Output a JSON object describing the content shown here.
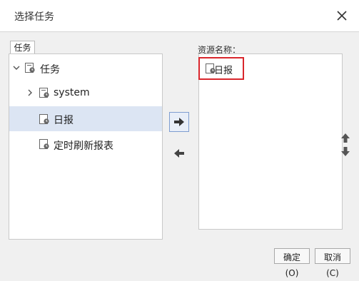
{
  "dialog": {
    "title": "选择任务",
    "close_icon": "close-icon"
  },
  "tree": {
    "tab_label": "任务",
    "nodes": [
      {
        "label": "任务",
        "icon": "task-folder-icon",
        "expanded": true,
        "selected": false
      },
      {
        "label": "system",
        "icon": "task-folder-icon",
        "expanded": false,
        "selected": false
      },
      {
        "label": "日报",
        "icon": "task-icon",
        "selected": true
      },
      {
        "label": "定时刷新报表",
        "icon": "task-icon",
        "selected": false
      }
    ]
  },
  "transfer": {
    "add_icon": "arrow-right-icon",
    "remove_icon": "arrow-left-icon"
  },
  "resources": {
    "label": "资源名称：",
    "items": [
      {
        "label": "日报",
        "icon": "task-icon",
        "highlighted": true
      }
    ],
    "reorder_icon": "arrow-up-down-icon"
  },
  "footer": {
    "ok_label": "确定(O)",
    "cancel_label": "取消(C)"
  },
  "colors": {
    "selection": "#dce5f3",
    "highlight_border": "#d9262c",
    "accent": "#7e9dd0"
  }
}
